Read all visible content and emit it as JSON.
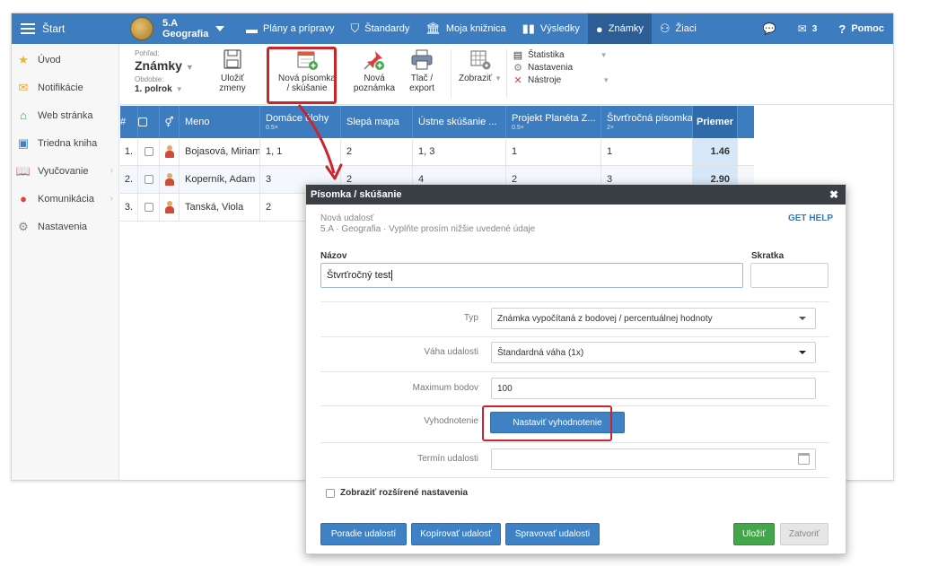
{
  "topbar": {
    "start_label": "Štart",
    "class_name": "5.A",
    "subject": "Geografia",
    "nav": [
      {
        "label": "Plány a prípravy"
      },
      {
        "label": "Štandardy"
      },
      {
        "label": "Moja knižnica"
      },
      {
        "label": "Výsledky"
      },
      {
        "label": "Známky"
      },
      {
        "label": "Žiaci"
      }
    ],
    "message_count": "3",
    "help_label": "Pomoc"
  },
  "sidebar": {
    "items": [
      {
        "label": "Úvod",
        "icon": "star-icon",
        "color": "#f2b51c"
      },
      {
        "label": "Notifikácie",
        "icon": "envelope-icon",
        "color": "#f0a23b"
      },
      {
        "label": "Web stránka",
        "icon": "home-icon",
        "color": "#3a9f4c"
      },
      {
        "label": "Triedna kniha",
        "icon": "book-icon",
        "color": "#3d7fc4"
      },
      {
        "label": "Vyučovanie",
        "icon": "open-book-icon",
        "color": "#3d7fc4"
      },
      {
        "label": "Komunikácia",
        "icon": "chat-icon",
        "color": "#d9443a"
      },
      {
        "label": "Nastavenia",
        "icon": "gear-icon",
        "color": "#888888"
      }
    ]
  },
  "toolbar": {
    "view_label": "Pohľad:",
    "view_value": "Známky",
    "period_label": "Obdobie:",
    "period_value": "1. polrok",
    "save_line1": "Uložiť",
    "save_line2": "zmeny",
    "newtest_line1": "Nová písomka",
    "newtest_line2": "/ skúšanie",
    "newnote_line1": "Nová",
    "newnote_line2": "poznámka",
    "print_line1": "Tlač /",
    "print_line2": "export",
    "display_label": "Zobraziť",
    "list": [
      "Štatistika",
      "Nastavenia",
      "Nástroje"
    ]
  },
  "grid": {
    "headers": {
      "num": "#",
      "name": "Meno",
      "cols": [
        {
          "label": "Domáce úlohy",
          "weight": "0.5×"
        },
        {
          "label": "Slepá mapa",
          "weight": ""
        },
        {
          "label": "Ústne skúšanie ...",
          "weight": ""
        },
        {
          "label": "Projekt Planéta Z...",
          "weight": "0.5×"
        },
        {
          "label": "Štvrťročná písomka",
          "weight": "2×"
        }
      ],
      "avg": "Priemer"
    },
    "rows": [
      {
        "num": "1.",
        "name": "Bojasová, Miriam",
        "g": [
          "1, 1",
          "2",
          "1, 3",
          "1",
          "1"
        ],
        "avg": "1.46"
      },
      {
        "num": "2.",
        "name": "Koperník, Adam",
        "g": [
          "3",
          "2",
          "4",
          "2",
          "3"
        ],
        "avg": "2.90"
      },
      {
        "num": "3.",
        "name": "Tanská, Viola",
        "g": [
          "2",
          "",
          "",
          "",
          ""
        ],
        "avg": ""
      }
    ]
  },
  "modal": {
    "title": "Písomka / skúšanie",
    "subtitle1": "Nová udalosť",
    "subtitle2": "5.A · Geografia · Vyplňte prosím nižšie uvedené údaje",
    "help": "GET HELP",
    "name_label": "Názov",
    "name_value": "Štvrťročný test",
    "abbr_label": "Skratka",
    "type_label": "Typ",
    "type_value": "Známka vypočítaná z bodovej / percentuálnej hodnoty",
    "weight_label": "Váha udalosti",
    "weight_value": "Štandardná váha (1x)",
    "max_label": "Maximum bodov",
    "max_value": "100",
    "eval_label": "Vyhodnotenie",
    "eval_button": "Nastaviť vyhodnotenie",
    "date_label": "Termín udalosti",
    "advanced_label": "Zobraziť rozšírené nastavenia",
    "btn_order": "Poradie udalostí",
    "btn_copy": "Kopírovať udalosť",
    "btn_manage": "Spravovať udalosti",
    "btn_save": "Uložiť",
    "btn_close": "Zatvoriť"
  }
}
